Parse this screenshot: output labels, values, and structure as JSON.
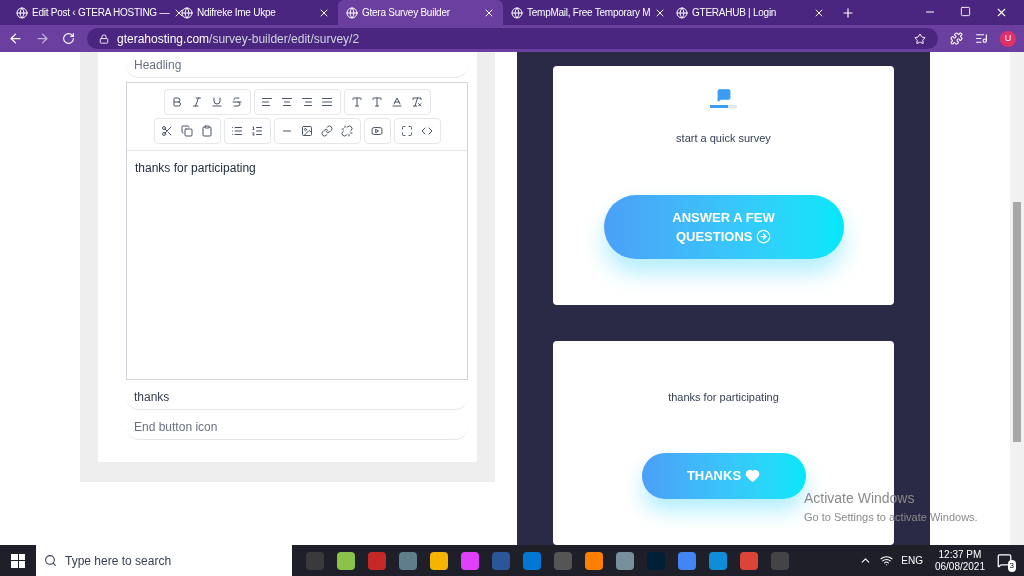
{
  "browser": {
    "tabs": [
      {
        "title": "Edit Post ‹ GTERA HOSTING —",
        "selected": false
      },
      {
        "title": "Ndifreke Ime Ukpe",
        "selected": false
      },
      {
        "title": "Gtera Survey Builder",
        "selected": true
      },
      {
        "title": "TempMail, Free Temporary M",
        "selected": false
      },
      {
        "title": "GTERAHUB | Login",
        "selected": false
      }
    ],
    "url_domain": "gterahosting.com",
    "url_path": "/survey-builder/edit/survey/2",
    "profile_initial": "U"
  },
  "editor": {
    "heading_placeholder": "Headling",
    "content": "thanks for participating",
    "end_button_text": "thanks",
    "end_button_icon_placeholder": "End button icon"
  },
  "preview": {
    "start_card": {
      "progress": {
        "level": 0.65
      },
      "text": "start a quick survey",
      "button": "ANSWER A FEW QUESTIONS"
    },
    "end_card": {
      "text": "thanks for participating",
      "button": "THANKS"
    }
  },
  "overlay": {
    "title": "Activate Windows",
    "subtitle": "Go to Settings to activate Windows."
  },
  "taskbar": {
    "search_placeholder": "Type here to search",
    "language": "ENG",
    "time": "12:37 PM",
    "date": "06/08/2021",
    "notifications": "3"
  }
}
